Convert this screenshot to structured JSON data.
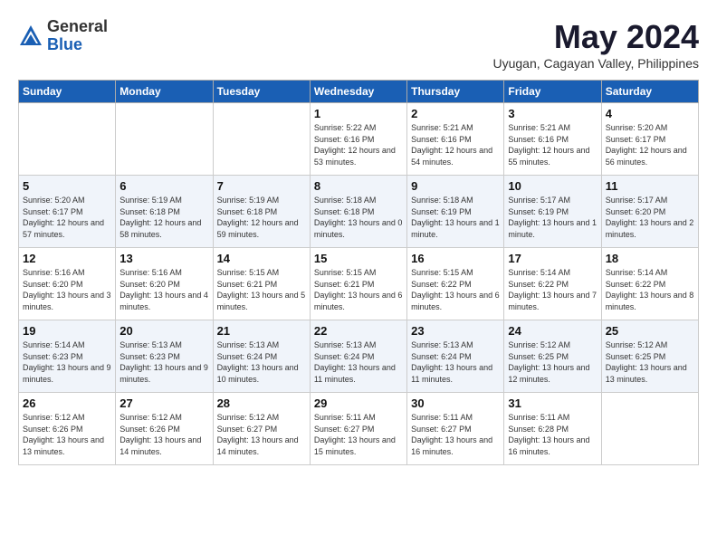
{
  "logo": {
    "general": "General",
    "blue": "Blue"
  },
  "title": "May 2024",
  "location": "Uyugan, Cagayan Valley, Philippines",
  "weekdays": [
    "Sunday",
    "Monday",
    "Tuesday",
    "Wednesday",
    "Thursday",
    "Friday",
    "Saturday"
  ],
  "weeks": [
    [
      {
        "day": "",
        "sunrise": "",
        "sunset": "",
        "daylight": ""
      },
      {
        "day": "",
        "sunrise": "",
        "sunset": "",
        "daylight": ""
      },
      {
        "day": "",
        "sunrise": "",
        "sunset": "",
        "daylight": ""
      },
      {
        "day": "1",
        "sunrise": "Sunrise: 5:22 AM",
        "sunset": "Sunset: 6:16 PM",
        "daylight": "Daylight: 12 hours and 53 minutes."
      },
      {
        "day": "2",
        "sunrise": "Sunrise: 5:21 AM",
        "sunset": "Sunset: 6:16 PM",
        "daylight": "Daylight: 12 hours and 54 minutes."
      },
      {
        "day": "3",
        "sunrise": "Sunrise: 5:21 AM",
        "sunset": "Sunset: 6:16 PM",
        "daylight": "Daylight: 12 hours and 55 minutes."
      },
      {
        "day": "4",
        "sunrise": "Sunrise: 5:20 AM",
        "sunset": "Sunset: 6:17 PM",
        "daylight": "Daylight: 12 hours and 56 minutes."
      }
    ],
    [
      {
        "day": "5",
        "sunrise": "Sunrise: 5:20 AM",
        "sunset": "Sunset: 6:17 PM",
        "daylight": "Daylight: 12 hours and 57 minutes."
      },
      {
        "day": "6",
        "sunrise": "Sunrise: 5:19 AM",
        "sunset": "Sunset: 6:18 PM",
        "daylight": "Daylight: 12 hours and 58 minutes."
      },
      {
        "day": "7",
        "sunrise": "Sunrise: 5:19 AM",
        "sunset": "Sunset: 6:18 PM",
        "daylight": "Daylight: 12 hours and 59 minutes."
      },
      {
        "day": "8",
        "sunrise": "Sunrise: 5:18 AM",
        "sunset": "Sunset: 6:18 PM",
        "daylight": "Daylight: 13 hours and 0 minutes."
      },
      {
        "day": "9",
        "sunrise": "Sunrise: 5:18 AM",
        "sunset": "Sunset: 6:19 PM",
        "daylight": "Daylight: 13 hours and 1 minute."
      },
      {
        "day": "10",
        "sunrise": "Sunrise: 5:17 AM",
        "sunset": "Sunset: 6:19 PM",
        "daylight": "Daylight: 13 hours and 1 minute."
      },
      {
        "day": "11",
        "sunrise": "Sunrise: 5:17 AM",
        "sunset": "Sunset: 6:20 PM",
        "daylight": "Daylight: 13 hours and 2 minutes."
      }
    ],
    [
      {
        "day": "12",
        "sunrise": "Sunrise: 5:16 AM",
        "sunset": "Sunset: 6:20 PM",
        "daylight": "Daylight: 13 hours and 3 minutes."
      },
      {
        "day": "13",
        "sunrise": "Sunrise: 5:16 AM",
        "sunset": "Sunset: 6:20 PM",
        "daylight": "Daylight: 13 hours and 4 minutes."
      },
      {
        "day": "14",
        "sunrise": "Sunrise: 5:15 AM",
        "sunset": "Sunset: 6:21 PM",
        "daylight": "Daylight: 13 hours and 5 minutes."
      },
      {
        "day": "15",
        "sunrise": "Sunrise: 5:15 AM",
        "sunset": "Sunset: 6:21 PM",
        "daylight": "Daylight: 13 hours and 6 minutes."
      },
      {
        "day": "16",
        "sunrise": "Sunrise: 5:15 AM",
        "sunset": "Sunset: 6:22 PM",
        "daylight": "Daylight: 13 hours and 6 minutes."
      },
      {
        "day": "17",
        "sunrise": "Sunrise: 5:14 AM",
        "sunset": "Sunset: 6:22 PM",
        "daylight": "Daylight: 13 hours and 7 minutes."
      },
      {
        "day": "18",
        "sunrise": "Sunrise: 5:14 AM",
        "sunset": "Sunset: 6:22 PM",
        "daylight": "Daylight: 13 hours and 8 minutes."
      }
    ],
    [
      {
        "day": "19",
        "sunrise": "Sunrise: 5:14 AM",
        "sunset": "Sunset: 6:23 PM",
        "daylight": "Daylight: 13 hours and 9 minutes."
      },
      {
        "day": "20",
        "sunrise": "Sunrise: 5:13 AM",
        "sunset": "Sunset: 6:23 PM",
        "daylight": "Daylight: 13 hours and 9 minutes."
      },
      {
        "day": "21",
        "sunrise": "Sunrise: 5:13 AM",
        "sunset": "Sunset: 6:24 PM",
        "daylight": "Daylight: 13 hours and 10 minutes."
      },
      {
        "day": "22",
        "sunrise": "Sunrise: 5:13 AM",
        "sunset": "Sunset: 6:24 PM",
        "daylight": "Daylight: 13 hours and 11 minutes."
      },
      {
        "day": "23",
        "sunrise": "Sunrise: 5:13 AM",
        "sunset": "Sunset: 6:24 PM",
        "daylight": "Daylight: 13 hours and 11 minutes."
      },
      {
        "day": "24",
        "sunrise": "Sunrise: 5:12 AM",
        "sunset": "Sunset: 6:25 PM",
        "daylight": "Daylight: 13 hours and 12 minutes."
      },
      {
        "day": "25",
        "sunrise": "Sunrise: 5:12 AM",
        "sunset": "Sunset: 6:25 PM",
        "daylight": "Daylight: 13 hours and 13 minutes."
      }
    ],
    [
      {
        "day": "26",
        "sunrise": "Sunrise: 5:12 AM",
        "sunset": "Sunset: 6:26 PM",
        "daylight": "Daylight: 13 hours and 13 minutes."
      },
      {
        "day": "27",
        "sunrise": "Sunrise: 5:12 AM",
        "sunset": "Sunset: 6:26 PM",
        "daylight": "Daylight: 13 hours and 14 minutes."
      },
      {
        "day": "28",
        "sunrise": "Sunrise: 5:12 AM",
        "sunset": "Sunset: 6:27 PM",
        "daylight": "Daylight: 13 hours and 14 minutes."
      },
      {
        "day": "29",
        "sunrise": "Sunrise: 5:11 AM",
        "sunset": "Sunset: 6:27 PM",
        "daylight": "Daylight: 13 hours and 15 minutes."
      },
      {
        "day": "30",
        "sunrise": "Sunrise: 5:11 AM",
        "sunset": "Sunset: 6:27 PM",
        "daylight": "Daylight: 13 hours and 16 minutes."
      },
      {
        "day": "31",
        "sunrise": "Sunrise: 5:11 AM",
        "sunset": "Sunset: 6:28 PM",
        "daylight": "Daylight: 13 hours and 16 minutes."
      },
      {
        "day": "",
        "sunrise": "",
        "sunset": "",
        "daylight": ""
      }
    ]
  ]
}
